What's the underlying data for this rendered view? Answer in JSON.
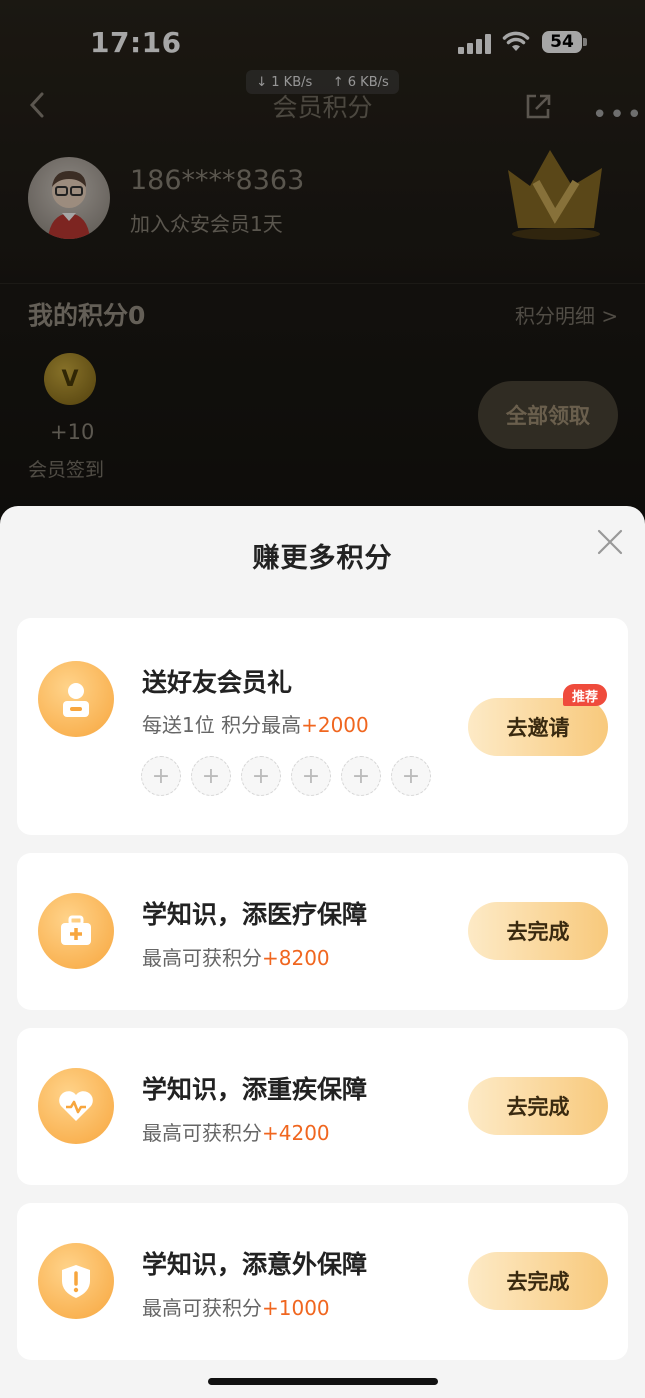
{
  "status_bar": {
    "time": "17:16",
    "download": "↓ 1 KB/s",
    "upload": "↑ 6 KB/s",
    "battery": "54"
  },
  "header": {
    "title": "会员积分"
  },
  "profile": {
    "phone": "186****8363",
    "joined": "加入众安会员1天"
  },
  "points": {
    "title": "我的积分0",
    "detail_link": "积分明细 >",
    "reward_amount": "+10",
    "reward_label": "会员签到",
    "collect_all": "全部领取"
  },
  "sheet": {
    "title": "赚更多积分",
    "tasks": [
      {
        "title": "送好友会员礼",
        "subtitle_prefix": "每送1位 积分最高",
        "highlight": "+2000",
        "button": "去邀请",
        "badge": "推荐",
        "icon": "user-gift-icon"
      },
      {
        "title": "学知识，添医疗保障",
        "subtitle_prefix": "最高可获积分",
        "highlight": "+8200",
        "button": "去完成",
        "icon": "medical-kit-icon"
      },
      {
        "title": "学知识，添重疾保障",
        "subtitle_prefix": "最高可获积分",
        "highlight": "+4200",
        "button": "去完成",
        "icon": "heart-pulse-icon"
      },
      {
        "title": "学知识，添意外保障",
        "subtitle_prefix": "最高可获积分",
        "highlight": "+1000",
        "button": "去完成",
        "icon": "shield-alert-icon"
      }
    ],
    "invite_slots": [
      "+",
      "+",
      "+",
      "+",
      "+",
      "+"
    ]
  },
  "colors": {
    "accent": "#f0661f",
    "badge": "#ef4b3c",
    "button_gradient_start": "#fdeac6",
    "button_gradient_end": "#f8c97c"
  }
}
